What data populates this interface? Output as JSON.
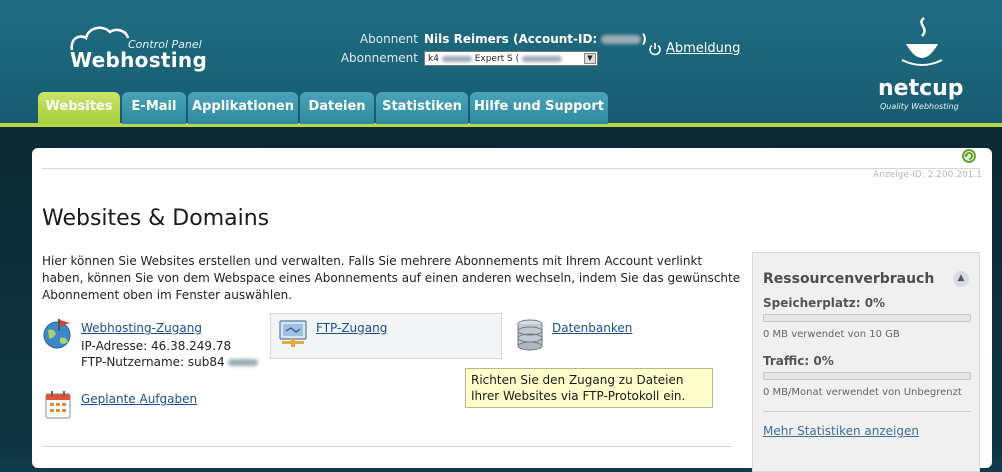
{
  "header": {
    "logo_small": "Control Panel",
    "logo_big": "Webhosting",
    "subscriber_label": "Abonnent",
    "subscriber_value": "Nils Reimers (Account-ID:",
    "subscriber_close": ")",
    "subscription_label": "Abonnement",
    "subscription_value_prefix": "k4",
    "subscription_value_mid": "Expert S (",
    "logout_label": "Abmeldung",
    "brand_name": "netcup",
    "brand_tagline": "Quality Webhosting"
  },
  "tabs": [
    {
      "label": "Websites",
      "active": true
    },
    {
      "label": "E-Mail",
      "active": false
    },
    {
      "label": "Applikationen",
      "active": false
    },
    {
      "label": "Dateien",
      "active": false
    },
    {
      "label": "Statistiken",
      "active": false
    },
    {
      "label": "Hilfe und Support",
      "active": false
    }
  ],
  "panel": {
    "display_id": "Anzeige-ID: 2.200.201.1",
    "title": "Websites & Domains",
    "intro": "Hier können Sie Websites erstellen und verwalten. Falls Sie mehrere Abonnements mit Ihrem Account verlinkt haben, können Sie von dem Webspace eines Abonnements auf einen anderen wechseln, indem Sie das gewünschte Abonnement oben im Fenster auswählen.",
    "webhosting_link": "Webhosting-Zugang",
    "ip_line": "IP-Adresse: 46.38.249.78",
    "ftp_user_line": "FTP-Nutzername: sub84",
    "ftp_link": "FTP-Zugang",
    "db_link": "Datenbanken",
    "tasks_link": "Geplante Aufgaben",
    "tooltip": "Richten Sie den Zugang zu Dateien Ihrer Websites via FTP-Protokoll ein."
  },
  "sidebar": {
    "title": "Ressourcenverbrauch",
    "storage_label": "Speicherplatz: 0%",
    "storage_percent": 0,
    "storage_detail": "0 MB verwendet von 10 GB",
    "traffic_label": "Traffic: 0%",
    "traffic_percent": 0,
    "traffic_detail": "0 MB/Monat verwendet von Unbegrenzt",
    "more_stats_link": "Mehr Statistiken anzeigen"
  },
  "colors": {
    "header_teal": "#1f6d82",
    "accent_green": "#b5d84a",
    "tab_blue": "#3a93a9",
    "link_blue": "#1a4f8b"
  }
}
